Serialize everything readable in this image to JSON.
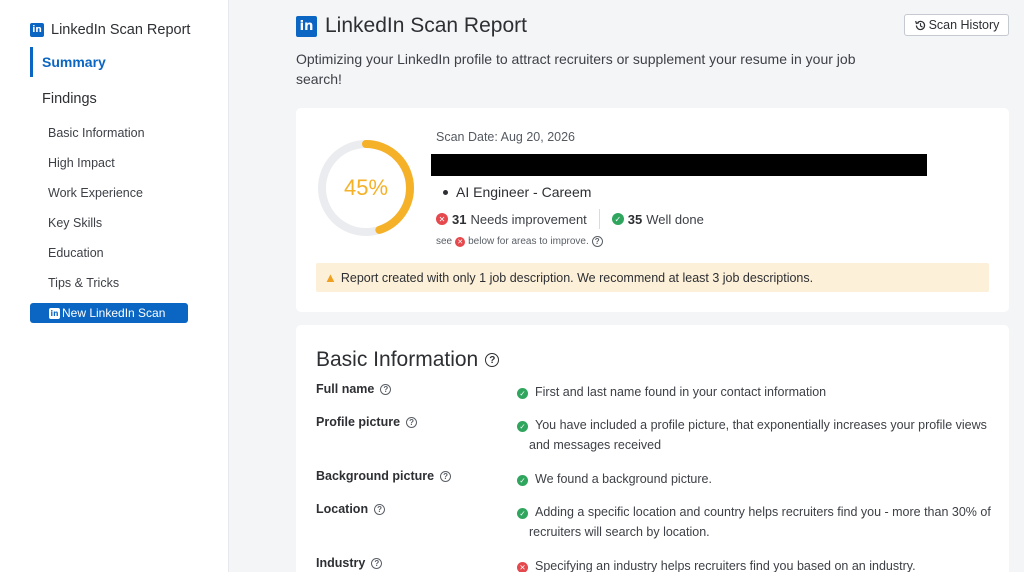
{
  "sidebar": {
    "brand": "LinkedIn Scan Report",
    "summary": "Summary",
    "findings": "Findings",
    "items": [
      {
        "label": "Basic Information"
      },
      {
        "label": "High Impact"
      },
      {
        "label": "Work Experience"
      },
      {
        "label": "Key Skills"
      },
      {
        "label": "Education"
      },
      {
        "label": "Tips & Tricks"
      }
    ],
    "new_scan": "New LinkedIn Scan"
  },
  "header": {
    "title": "LinkedIn Scan Report",
    "subtitle": "Optimizing your LinkedIn profile to attract recruiters or supplement your resume in your job search!",
    "scan_history": "Scan History"
  },
  "summary": {
    "score_text": "45%",
    "score": 45,
    "scan_date": "Scan Date: Aug 20, 2026",
    "job_title": "AI Engineer - Careem",
    "needs_count": "31",
    "needs_label": "Needs improvement",
    "done_count": "35",
    "done_label": "Well done",
    "see_pre": "see",
    "see_post": "below for areas to improve.",
    "warning": "Report created with only 1 job description. We recommend at least 3 job descriptions."
  },
  "basic": {
    "title": "Basic Information",
    "rows": [
      {
        "label": "Full name",
        "status": "ok",
        "text": "First and last name found in your contact information"
      },
      {
        "label": "Profile picture",
        "status": "ok",
        "text": "You have included a profile picture, that exponentially increases your profile views and messages received"
      },
      {
        "label": "Background picture",
        "status": "ok",
        "text": "We found a background picture."
      },
      {
        "label": "Location",
        "status": "ok",
        "text": "Adding a specific location and country helps recruiters find you - more than 30% of recruiters will search by location."
      },
      {
        "label": "Industry",
        "status": "bad",
        "text": "Specifying an industry helps recruiters find you based on an industry."
      }
    ]
  },
  "colors": {
    "accent": "#0a66c2",
    "gauge": "#f5b128",
    "ok": "#2fa55e",
    "bad": "#e5484d",
    "warning_bg": "#fdf0d8"
  }
}
